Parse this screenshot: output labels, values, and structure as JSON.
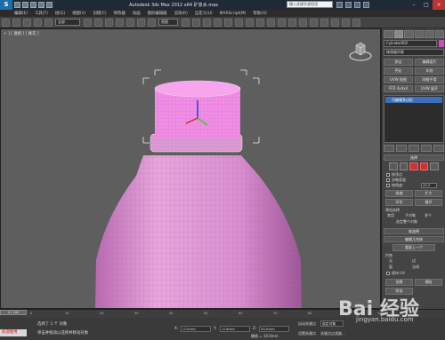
{
  "titlebar": {
    "app_logo": "S",
    "title": "Autodesk 3ds Max 2012 x64    矿泉水.max",
    "search_placeholder": "输入关键字或短语"
  },
  "menubar": {
    "items": [
      "编辑(E)",
      "工具(T)",
      "组(G)",
      "视图(V)",
      "创建(C)",
      "修改器",
      "动画",
      "图形编辑器",
      "渲染(R)",
      "自定义(U)",
      "MAXScript(M)",
      "帮助(H)"
    ]
  },
  "toolbar": {
    "selection_filter": "全部",
    "reference_system": "视图"
  },
  "viewport": {
    "label": "+ ] [ 透视 ] [ 真实 ]"
  },
  "command_panel": {
    "object_name": "Cylinder002",
    "modifier_list": "修改器列表",
    "buttons": [
      [
        "挤出",
        "编辑面片"
      ],
      [
        "壳化",
        "车削"
      ],
      [
        "UVW 贴图",
        "网格平滑"
      ],
      [
        "FFD 4x4x4",
        "UVW 展开"
      ]
    ],
    "stack_item": "可编辑多边形",
    "selection_rollout": "选择",
    "by_vertex": "按顶点",
    "ignore_backfacing": "忽略背面",
    "by_angle": "按角度:",
    "angle_value": "45.0",
    "shrink": "收缩",
    "grow": "扩大",
    "ring": "环形",
    "loop": "循环",
    "preview_selection": "预览选择",
    "disabled": "禁用",
    "subobject": "子对象",
    "multi": "多个",
    "selected_count": "选定整个对象",
    "soft_selection_rollout": "软选择",
    "edit_geometry_rollout": "编辑几何体",
    "repeat_last": "重复上一个",
    "constraints": "约束",
    "none": "无",
    "edge": "边",
    "face": "面",
    "normal": "法线",
    "preserve_uvs": "保持 UV",
    "create": "创建",
    "collapse": "塌陷",
    "attach": "附加"
  },
  "timeline": {
    "slider_label": "0 / 100",
    "ticks": [
      "0",
      "10",
      "20",
      "30",
      "40",
      "50",
      "60",
      "70",
      "80",
      "90",
      "100"
    ]
  },
  "statusbar": {
    "maxscript": "欢迎使用",
    "status1": "选择了 1 个 对象",
    "status2": "单击并拖动以选择并移动对象",
    "x_label": "X:",
    "x_value": "-0.0mm",
    "y_label": "Y:",
    "y_value": "-0.0mm",
    "z_label": "Z:",
    "z_value": "30.0mm",
    "grid": "栅格 = 10.0mm",
    "auto_key": "自动关键点",
    "selected": "选定对象",
    "set_key": "设置关键点",
    "key_filters": "关键点过滤器..."
  },
  "watermark": {
    "text": "Bai 经验",
    "sub": "jingyan.baidu.com"
  }
}
